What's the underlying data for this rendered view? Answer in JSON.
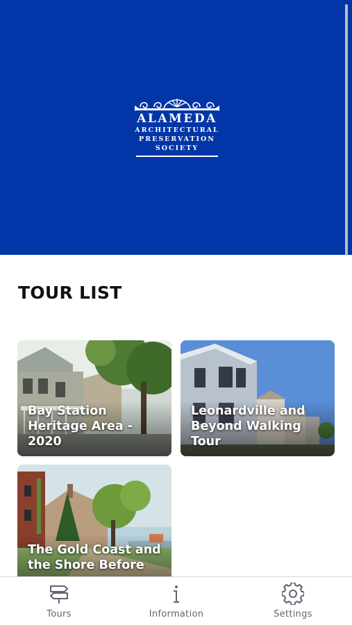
{
  "header": {
    "logo": {
      "line1": "ALAMEDA",
      "line2": "ARCHITECTURAL",
      "line3": "PRESERVATION",
      "line4": "SOCIETY"
    },
    "background_color": "#0236a8"
  },
  "main": {
    "section_title": "TOUR LIST",
    "tours": [
      {
        "title": "Bay Station Heritage Area - 2020"
      },
      {
        "title": "Leonardville and Beyond Walking Tour"
      },
      {
        "title": "The Gold Coast and the Shore Before"
      }
    ]
  },
  "tabbar": {
    "items": [
      {
        "label": "Tours",
        "icon": "signpost-icon"
      },
      {
        "label": "Information",
        "icon": "info-icon"
      },
      {
        "label": "Settings",
        "icon": "gear-icon"
      }
    ]
  }
}
